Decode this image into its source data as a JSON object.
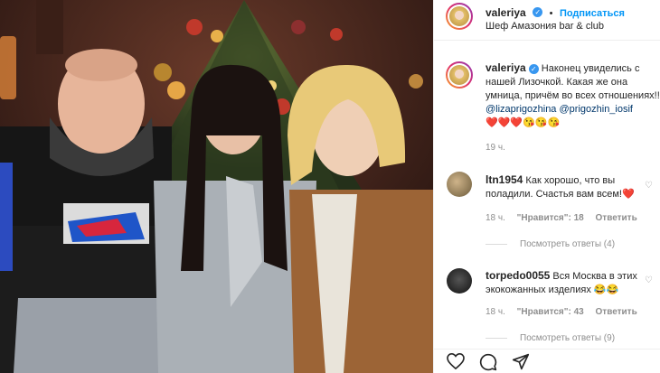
{
  "post": {
    "username": "valeriya",
    "subscribe_label": "Подписаться",
    "location": "Шеф Амазония bar & club",
    "separator": "•"
  },
  "caption": {
    "username": "valeriya",
    "text": "Наконец увиделись с нашей Лизочкой. Какая же она умница, причём во всех отношениях!!!! ",
    "mention1": "@lizaprigozhina",
    "mention2": "@prigozhin_iosif",
    "emoji": "❤️❤️❤️😘😘😘",
    "time": "19 ч."
  },
  "comments": [
    {
      "username": "ltn1954",
      "text": "Как хорошо, что вы поладили. Счастья вам всем!",
      "emoji": "❤️",
      "time": "18 ч.",
      "likes": "\"Нравится\": 18",
      "reply": "Ответить",
      "view_replies": "Посмотреть ответы (4)"
    },
    {
      "username": "torpedo0055",
      "text": "Вся Москва в этих экокожанных изделиях",
      "emoji": "😂😂",
      "time": "18 ч.",
      "likes": "\"Нравится\": 43",
      "reply": "Ответить",
      "view_replies": "Посмотреть ответы (9)"
    }
  ],
  "icons": {
    "like": "heart-icon",
    "comment": "comment-icon",
    "share": "paper-plane-icon",
    "verified": "verified-badge-icon"
  },
  "colors": {
    "accent": "#0095f6",
    "verified": "#3897f0",
    "heart": "#ed4956",
    "muted": "#8e8e8e"
  }
}
